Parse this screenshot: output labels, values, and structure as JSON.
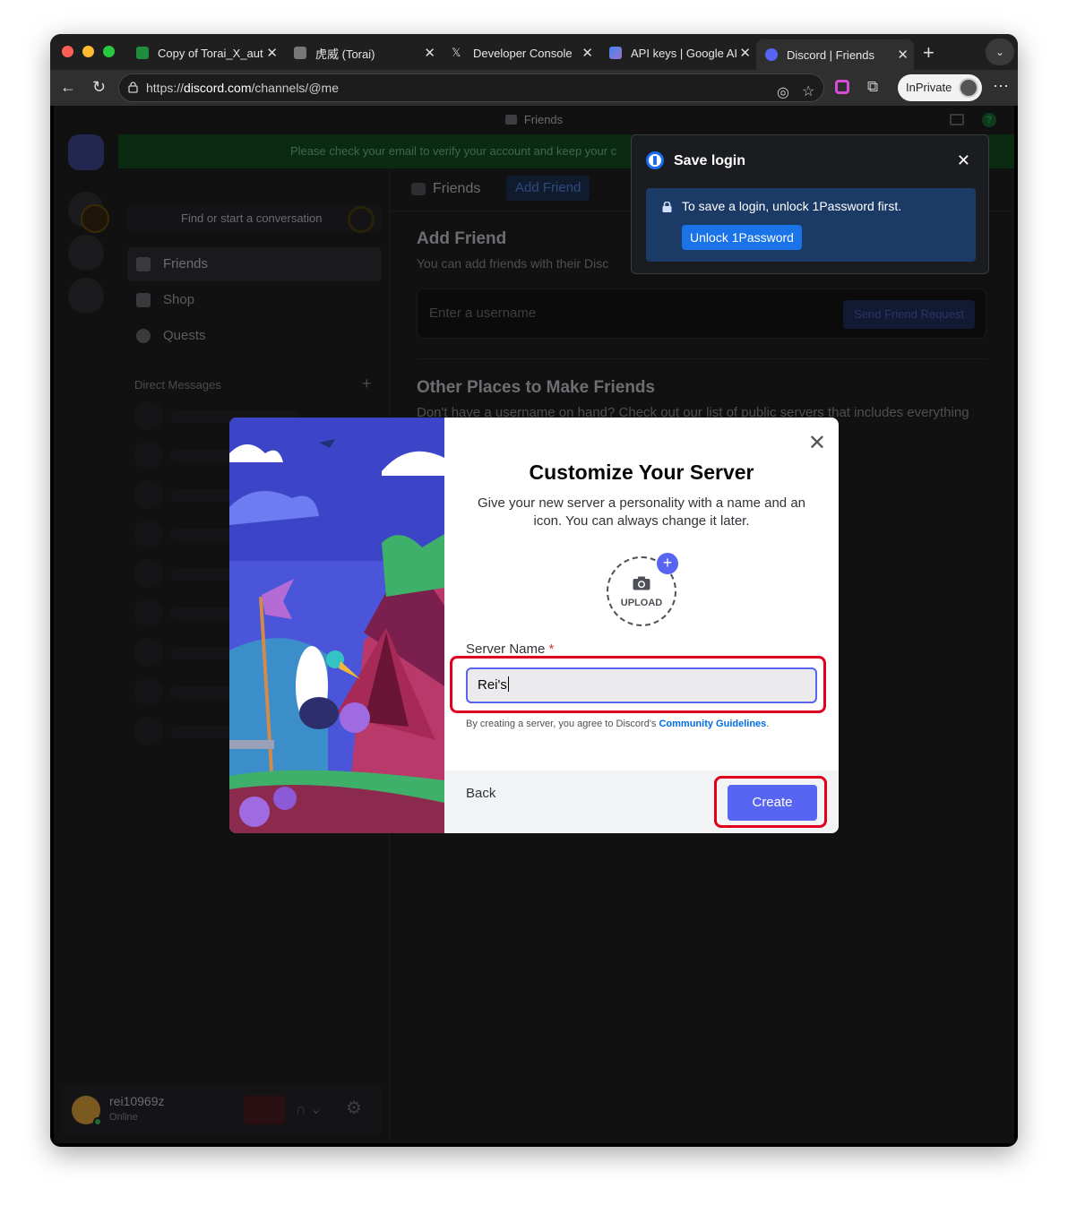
{
  "browser": {
    "tabs": [
      {
        "title": "Copy of Torai_X_auto",
        "icon": "sheets-icon",
        "color": "#1e8e3e"
      },
      {
        "title": "虎威 (Torai)",
        "icon": "site-icon",
        "color": "#888888"
      },
      {
        "title": "Developer Console",
        "icon": "x-logo-icon",
        "color": "#ffffff"
      },
      {
        "title": "API keys | Google AI",
        "icon": "google-ai-icon",
        "color": "#4285f4"
      },
      {
        "title": "Discord | Friends",
        "icon": "discord-icon",
        "color": "#5865f2"
      }
    ],
    "url_prefix": "https://",
    "url_host": "discord.com",
    "url_path": "/channels/@me",
    "inprivate_label": "InPrivate"
  },
  "discord": {
    "window_title": "Friends",
    "verify_banner": "Please check your email to verify your account and keep your c",
    "search_placeholder": "Find or start a conversation",
    "nav": [
      {
        "label": "Friends",
        "icon": "friends-icon"
      },
      {
        "label": "Shop",
        "icon": "shop-icon"
      },
      {
        "label": "Quests",
        "icon": "quests-icon"
      }
    ],
    "dm_header": "Direct Messages",
    "user": {
      "name": "rei10969z",
      "status": "Online"
    },
    "main_header": {
      "friends": "Friends",
      "add_friend": "Add Friend"
    },
    "add_friend": {
      "title": "Add Friend",
      "subtitle": "You can add friends with their Disc",
      "input_placeholder": "Enter a username",
      "send_button": "Send Friend Request"
    },
    "other_places": {
      "title": "Other Places to Make Friends",
      "subtitle": "Don't have a username on hand? Check out our list of public servers that includes everything"
    }
  },
  "onepassword": {
    "title": "Save login",
    "message": "To save a login, unlock 1Password first.",
    "unlock_button": "Unlock 1Password"
  },
  "modal": {
    "title": "Customize Your Server",
    "subtitle": "Give your new server a personality with a name and an icon. You can always change it later.",
    "upload_label": "UPLOAD",
    "server_name_label": "Server Name",
    "required_mark": "*",
    "server_name_value": "Rei's",
    "terms_text": "By creating a server, you agree to Discord's ",
    "terms_link": "Community Guidelines",
    "terms_end": ".",
    "back_label": "Back",
    "create_label": "Create"
  }
}
